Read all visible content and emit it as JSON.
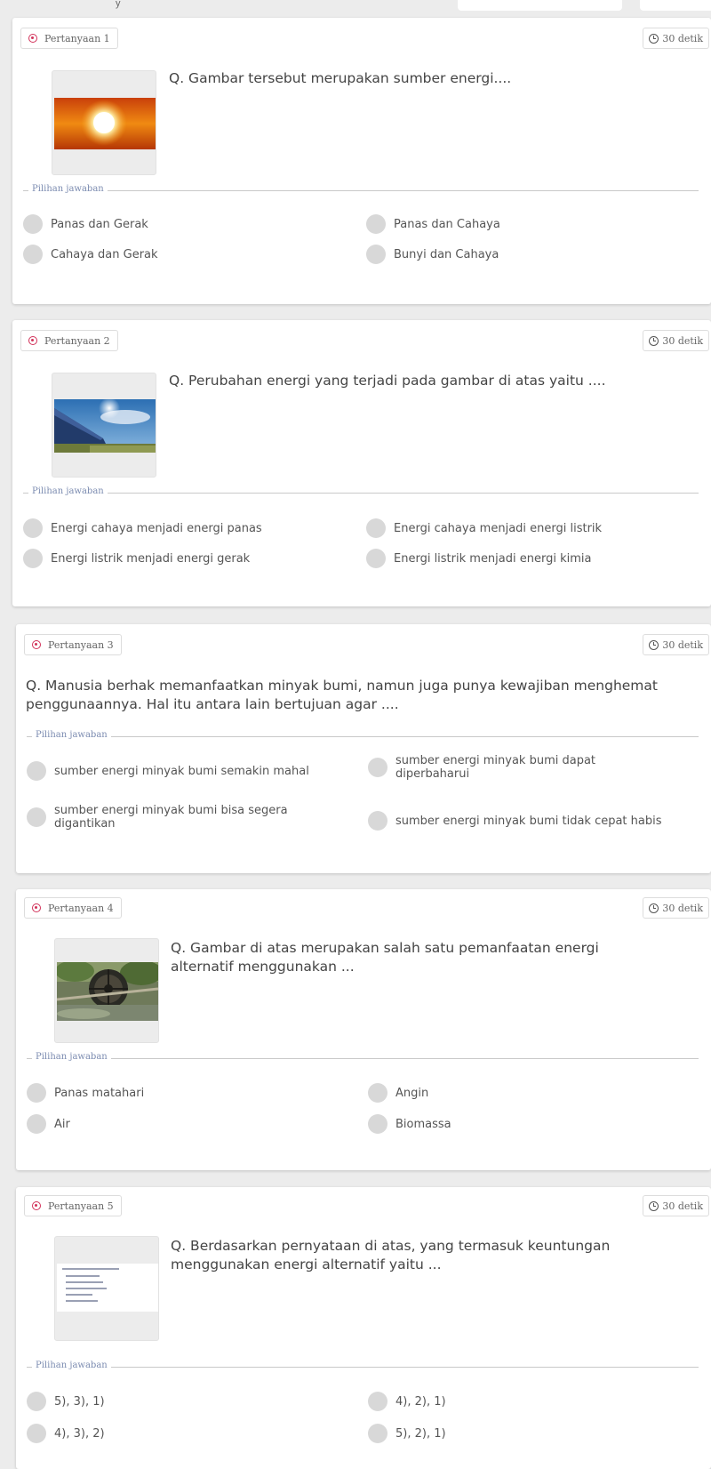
{
  "top_fragment": "y",
  "answer_section_label": "Pilihan jawaban",
  "questions": [
    {
      "tag": "Pertanyaan 1",
      "time": "30 detik",
      "text": "Q. Gambar tersebut merupakan sumber energi....",
      "image": "sun-sunset-image",
      "options": [
        "Panas dan Gerak",
        "Panas dan Cahaya",
        "Cahaya dan Gerak",
        "Bunyi dan Cahaya"
      ]
    },
    {
      "tag": "Pertanyaan 2",
      "time": "30 detik",
      "text": "Q. Perubahan energi yang terjadi pada gambar di atas yaitu ....",
      "image": "solar-panel-image",
      "options": [
        "Energi cahaya menjadi energi panas",
        "Energi cahaya menjadi energi listrik",
        "Energi listrik menjadi energi gerak",
        "Energi listrik menjadi energi kimia"
      ]
    },
    {
      "tag": "Pertanyaan 3",
      "time": "30 detik",
      "text": "Q. Manusia berhak memanfaatkan minyak bumi, namun juga punya kewajiban menghemat penggunaannya. Hal itu antara lain bertujuan agar ....",
      "options": [
        "sumber energi minyak bumi semakin mahal",
        "sumber energi minyak bumi dapat diperbaharui",
        "sumber energi minyak bumi bisa segera digantikan",
        "sumber energi minyak bumi tidak cepat habis"
      ]
    },
    {
      "tag": "Pertanyaan 4",
      "time": "30 detik",
      "text": "Q. Gambar di atas merupakan salah satu pemanfaatan energi alternatif menggunakan ...",
      "image": "waterwheel-image",
      "options": [
        "Panas matahari",
        "Angin",
        "Air",
        "Biomassa"
      ]
    },
    {
      "tag": "Pertanyaan 5",
      "time": "30 detik",
      "text": "Q. Berdasarkan pernyataan di atas, yang termasuk keuntungan menggunakan energi alternatif yaitu ...",
      "image": "statement-list-image",
      "options": [
        "5), 3), 1)",
        "4), 2), 1)",
        "4), 3), 2)",
        "5), 2), 1)"
      ]
    }
  ],
  "colors": {
    "question_icon": "#d2325a",
    "radio": "#d8d8d8",
    "section_label": "#7b8bb0"
  }
}
